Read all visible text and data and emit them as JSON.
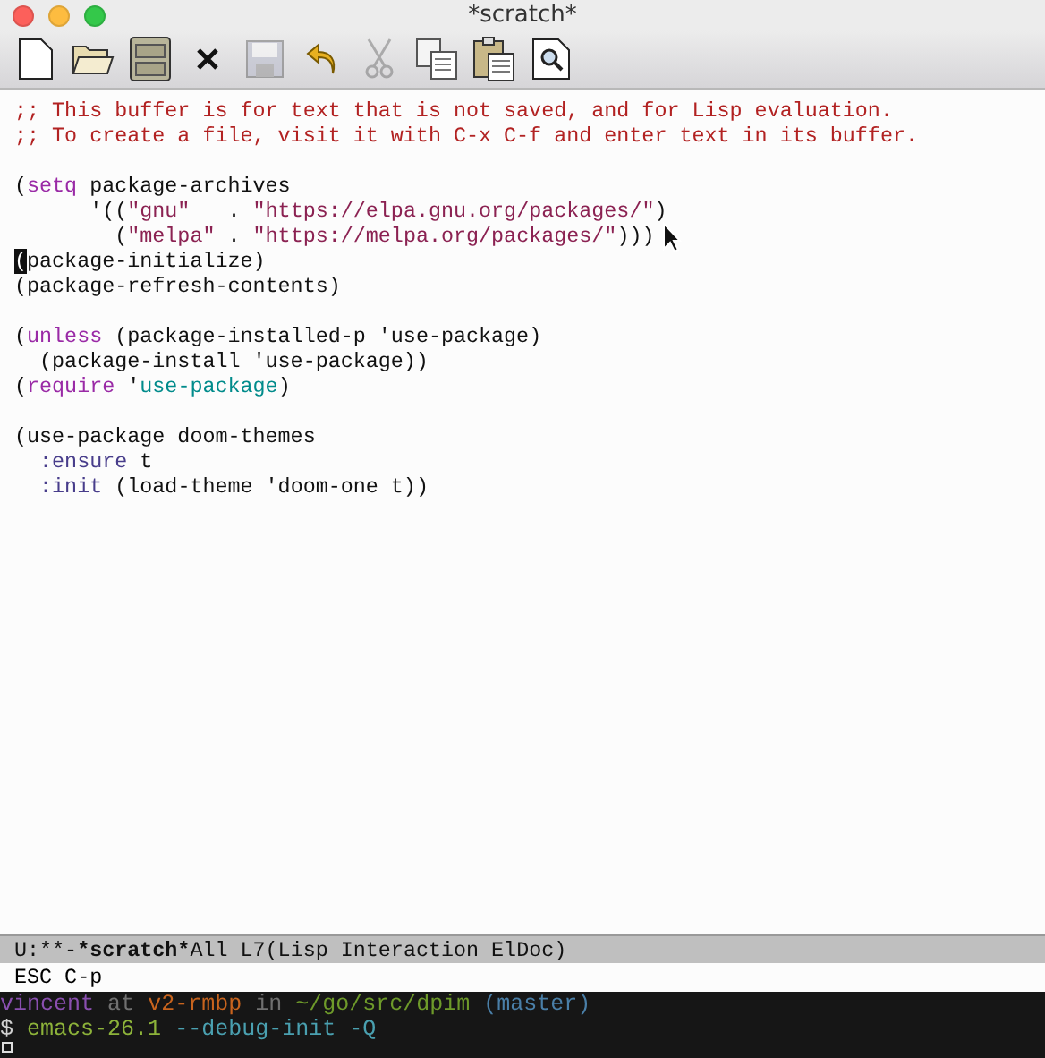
{
  "window": {
    "title": "*scratch*"
  },
  "toolbar": [
    {
      "kind": "new-file",
      "disabled": false
    },
    {
      "kind": "open-folder",
      "disabled": false
    },
    {
      "kind": "cabinet",
      "disabled": false
    },
    {
      "kind": "close",
      "disabled": false
    },
    {
      "kind": "save",
      "disabled": true
    },
    {
      "kind": "undo",
      "disabled": false
    },
    {
      "kind": "cut",
      "disabled": true
    },
    {
      "kind": "copy",
      "disabled": false
    },
    {
      "kind": "paste",
      "disabled": false
    },
    {
      "kind": "search",
      "disabled": false
    }
  ],
  "editor": {
    "lines": [
      {
        "kind": "code",
        "segments": [
          {
            "kind": "comment",
            "text": ";; This buffer is for text that is not saved, and for Lisp evaluation."
          }
        ]
      },
      {
        "kind": "code",
        "segments": [
          {
            "kind": "comment",
            "text": ";; To create a file, visit it with C-x C-f and enter text in its buffer."
          }
        ]
      },
      {
        "kind": "blank"
      },
      {
        "kind": "code",
        "segments": [
          {
            "kind": "plain",
            "text": "("
          },
          {
            "kind": "keyword",
            "text": "setq"
          },
          {
            "kind": "plain",
            "text": " package-archives"
          }
        ]
      },
      {
        "kind": "code",
        "segments": [
          {
            "kind": "plain",
            "text": "      '(("
          },
          {
            "kind": "string",
            "text": "\"gnu\""
          },
          {
            "kind": "plain",
            "text": "   . "
          },
          {
            "kind": "string",
            "text": "\"https://elpa.gnu.org/packages/\""
          },
          {
            "kind": "plain",
            "text": ")"
          }
        ]
      },
      {
        "kind": "code",
        "segments": [
          {
            "kind": "plain",
            "text": "        ("
          },
          {
            "kind": "string",
            "text": "\"melpa\""
          },
          {
            "kind": "plain",
            "text": " . "
          },
          {
            "kind": "string",
            "text": "\"https://melpa.org/packages/\""
          },
          {
            "kind": "plain",
            "text": ")))"
          }
        ]
      },
      {
        "kind": "code",
        "segments": [
          {
            "kind": "cursor",
            "text": "("
          },
          {
            "kind": "plain",
            "text": "package-initialize)"
          }
        ]
      },
      {
        "kind": "code",
        "segments": [
          {
            "kind": "plain",
            "text": "(package-refresh-contents)"
          }
        ]
      },
      {
        "kind": "blank"
      },
      {
        "kind": "code",
        "segments": [
          {
            "kind": "plain",
            "text": "("
          },
          {
            "kind": "keyword",
            "text": "unless"
          },
          {
            "kind": "plain",
            "text": " (package-installed-p 'use-package)"
          }
        ]
      },
      {
        "kind": "code",
        "segments": [
          {
            "kind": "plain",
            "text": "  (package-install 'use-package))"
          }
        ]
      },
      {
        "kind": "code",
        "segments": [
          {
            "kind": "plain",
            "text": "("
          },
          {
            "kind": "keyword",
            "text": "require"
          },
          {
            "kind": "plain",
            "text": " '"
          },
          {
            "kind": "constant",
            "text": "use-package"
          },
          {
            "kind": "plain",
            "text": ")"
          }
        ]
      },
      {
        "kind": "blank"
      },
      {
        "kind": "code",
        "segments": [
          {
            "kind": "plain",
            "text": "(use-package doom-themes"
          }
        ]
      },
      {
        "kind": "code",
        "segments": [
          {
            "kind": "builtin",
            "text": "  :ensure"
          },
          {
            "kind": "plain",
            "text": " t"
          }
        ]
      },
      {
        "kind": "code",
        "segments": [
          {
            "kind": "builtin",
            "text": "  :init"
          },
          {
            "kind": "plain",
            "text": " (load-theme 'doom-one t))"
          }
        ]
      }
    ]
  },
  "mode_line": {
    "status": "U:**-",
    "buffer": "*scratch*",
    "position": "All L7",
    "modes": "(Lisp Interaction ElDoc)"
  },
  "minibuffer": "ESC C-p",
  "terminal": {
    "lines": [
      [
        {
          "text": "vincent",
          "color": "#8a4fb0"
        },
        {
          "text": "at",
          "color": "#707070"
        },
        {
          "text": "v2-rmbp",
          "color": "#c8641e"
        },
        {
          "text": "in",
          "color": "#707070"
        },
        {
          "text": "~/go/src/dpim",
          "color": "#6e9a2a"
        },
        {
          "text": "(master)",
          "color": "#4a7fa8"
        }
      ],
      [
        {
          "text": "$",
          "color": "#d0d0d0"
        },
        {
          "text": "emacs-26.1",
          "color": "#8db33a"
        },
        {
          "text": "--debug-init -Q",
          "color": "#4aa0b0"
        }
      ]
    ]
  }
}
